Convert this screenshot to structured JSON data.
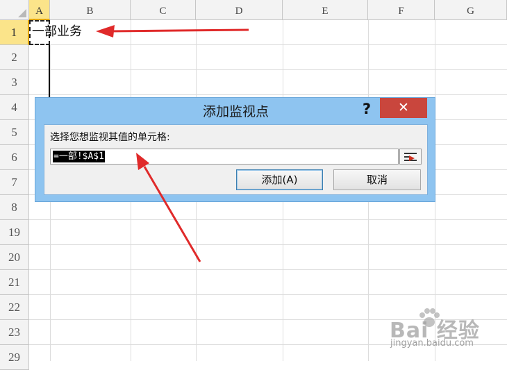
{
  "spreadsheet": {
    "columns": [
      "A",
      "B",
      "C",
      "D",
      "E",
      "F",
      "G"
    ],
    "rows": [
      "1",
      "2",
      "3",
      "4",
      "5",
      "6",
      "7",
      "8",
      "19",
      "20",
      "21",
      "22",
      "23",
      "29"
    ],
    "cell_a1_text": "一部业务"
  },
  "dialog": {
    "title": "添加监视点",
    "help_label": "?",
    "close_label": "✕",
    "prompt": "选择您想监视其值的单元格:",
    "reference_value": "=一部!$A$1",
    "add_button": "添加(A)",
    "cancel_button": "取消"
  },
  "watermark": {
    "logo": "Bai 经验",
    "url": "jingyan.baidu.com"
  },
  "colors": {
    "selected_header": "#fbe48a",
    "dialog_frame": "#8ec4f0",
    "close_button": "#c9463d",
    "annotation_arrow": "#e02a2a"
  },
  "icons": {
    "help": "question-mark-icon",
    "close": "close-x-icon",
    "collapse": "range-select-icon"
  }
}
